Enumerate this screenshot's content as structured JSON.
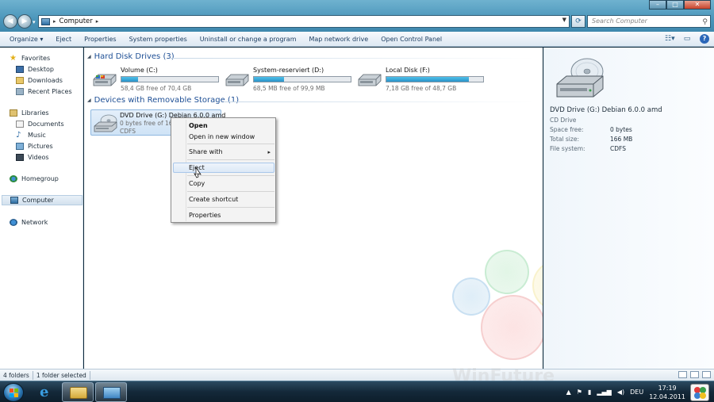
{
  "window": {
    "controls": {
      "minimize": "–",
      "maximize": "□",
      "close": "✕"
    }
  },
  "address": {
    "location": "Computer",
    "search_placeholder": "Search Computer"
  },
  "toolbar": {
    "organize": "Organize ▾",
    "eject": "Eject",
    "properties": "Properties",
    "system_properties": "System properties",
    "uninstall": "Uninstall or change a program",
    "map_drive": "Map network drive",
    "control_panel": "Open Control Panel"
  },
  "nav": {
    "favorites": "Favorites",
    "desktop": "Desktop",
    "downloads": "Downloads",
    "recent_places": "Recent Places",
    "libraries": "Libraries",
    "documents": "Documents",
    "music": "Music",
    "pictures": "Pictures",
    "videos": "Videos",
    "homegroup": "Homegroup",
    "computer": "Computer",
    "network": "Network"
  },
  "groups": {
    "hdd": "Hard Disk Drives (3)",
    "removable": "Devices with Removable Storage (1)"
  },
  "drives": [
    {
      "name": "Volume (C:)",
      "free": "58,4 GB free of 70,4 GB",
      "used_fraction": 0.17
    },
    {
      "name": "System-reserviert (D:)",
      "free": "68,5 MB free of 99,9 MB",
      "used_fraction": 0.31
    },
    {
      "name": "Local Disk (F:)",
      "free": "7,18 GB free of 48,7 GB",
      "used_fraction": 0.85
    }
  ],
  "dvd": {
    "name": "DVD Drive (G:) Debian 6.0.0 amd",
    "free": "0 bytes free of 166",
    "fs": "CDFS"
  },
  "context_menu": {
    "open": "Open",
    "open_new_window": "Open in new window",
    "share_with": "Share with",
    "eject": "Eject",
    "copy": "Copy",
    "create_shortcut": "Create shortcut",
    "properties": "Properties"
  },
  "details": {
    "title": "DVD Drive (G:) Debian 6.0.0 amd",
    "subtitle": "CD Drive",
    "space_free_label": "Space free:",
    "space_free": "0 bytes",
    "total_size_label": "Total size:",
    "total_size": "166 MB",
    "file_system_label": "File system:",
    "file_system": "CDFS"
  },
  "status": {
    "folders": "4 folders",
    "selected": "1 folder selected"
  },
  "watermark": "WinFuture",
  "taskbar": {
    "language": "DEU",
    "time": "17:19",
    "date": "12.04.2011"
  }
}
